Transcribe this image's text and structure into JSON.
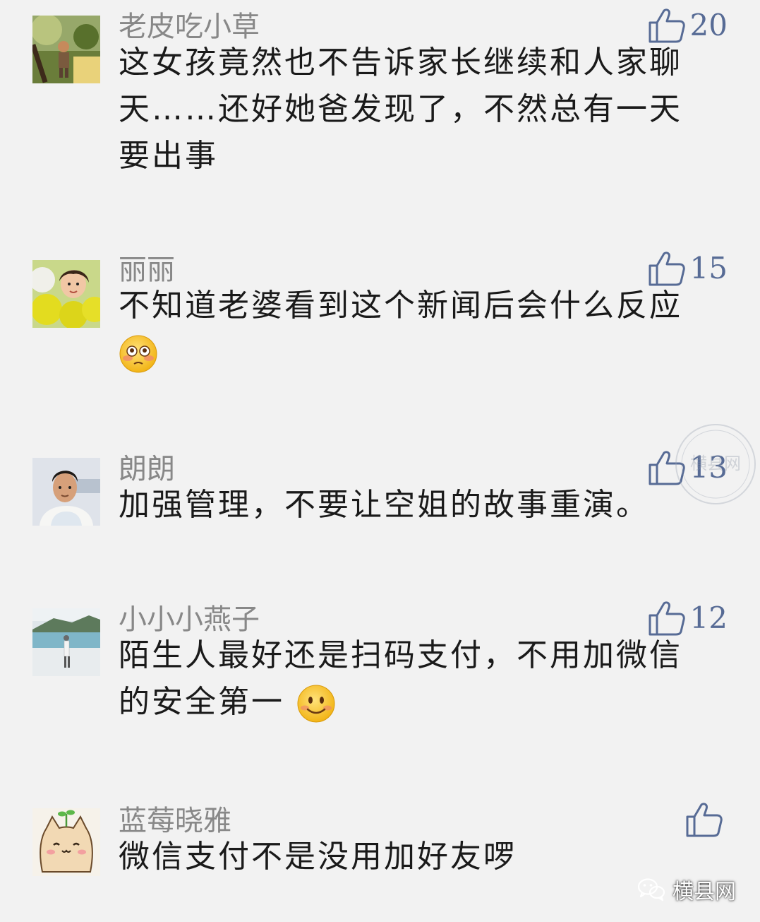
{
  "comments": [
    {
      "nickname": "老皮吃小草",
      "likes": "20",
      "avatar": "avatar-photo-nature",
      "lines": [
        "这女孩竟然也不告诉家长继续和人家聊",
        "天……还好她爸发现了，不然总有一天",
        "要出事"
      ]
    },
    {
      "nickname": "丽丽",
      "likes": "15",
      "avatar": "avatar-photo-balloons",
      "lines": [
        "不知道老婆看到这个新闻后会什么反应"
      ],
      "emoji": "flushed-face-emoji"
    },
    {
      "nickname": "朗朗",
      "likes": "13",
      "avatar": "avatar-photo-man",
      "lines": [
        "加强管理，不要让空姐的故事重演。"
      ]
    },
    {
      "nickname": "小小小燕子",
      "likes": "12",
      "avatar": "avatar-photo-lake",
      "lines": [
        "陌生人最好还是扫码支付，不用加微信",
        "的安全第一"
      ],
      "emoji": "smile-face-emoji"
    },
    {
      "nickname": "蓝莓晓雅",
      "likes": "",
      "avatar": "avatar-cartoon-cat",
      "lines": [
        "微信支付不是没用加好友啰"
      ]
    }
  ],
  "watermark": {
    "text": "横县网"
  },
  "footer": {
    "brand": "横县网",
    "icon": "wechat-icon"
  },
  "colors": {
    "background": "#f2f2f2",
    "like_blue": "#576b95",
    "nickname_gray": "#888888",
    "text": "#1a1a1a"
  }
}
